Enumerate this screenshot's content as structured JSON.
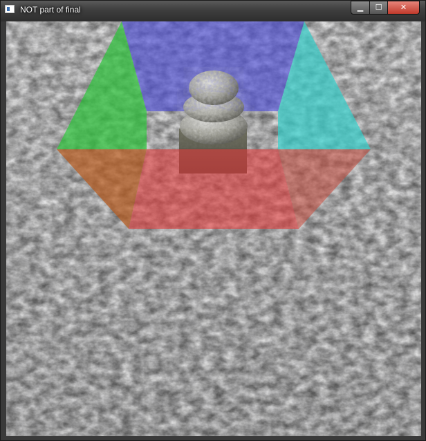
{
  "window": {
    "title": "NOT part of final",
    "controls": {
      "minimize": "▁",
      "maximize": "☐",
      "close": "✕"
    }
  },
  "scene": {
    "floor_texture": "snow-ground",
    "box_walls": [
      {
        "name": "back-wall",
        "color": "#5a5ad0"
      },
      {
        "name": "left-wall",
        "color": "#3cc84a"
      },
      {
        "name": "right-wall",
        "color": "#40d0cc"
      },
      {
        "name": "front-wall",
        "color": "#e04848"
      }
    ],
    "object": "stacked-stone-cairn"
  }
}
